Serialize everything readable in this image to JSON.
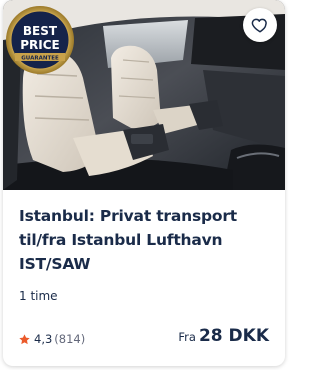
{
  "badge": {
    "line1": "BEST",
    "line2": "PRICE",
    "line3": "GUARANTEE"
  },
  "product": {
    "title": "Istanbul: Privat transport til/fra Istanbul Lufthavn IST/SAW",
    "duration": "1 time",
    "rating": "4,3",
    "review_count": "(814)",
    "price_prefix": "Fra",
    "price": "28 DKK"
  },
  "icons": {
    "wishlist": "heart-icon",
    "rating": "star-icon"
  },
  "colors": {
    "title_text": "#1a2b49",
    "star": "#eb5a2b",
    "badge_navy": "#15234a",
    "badge_gold": "#c9a24a"
  }
}
